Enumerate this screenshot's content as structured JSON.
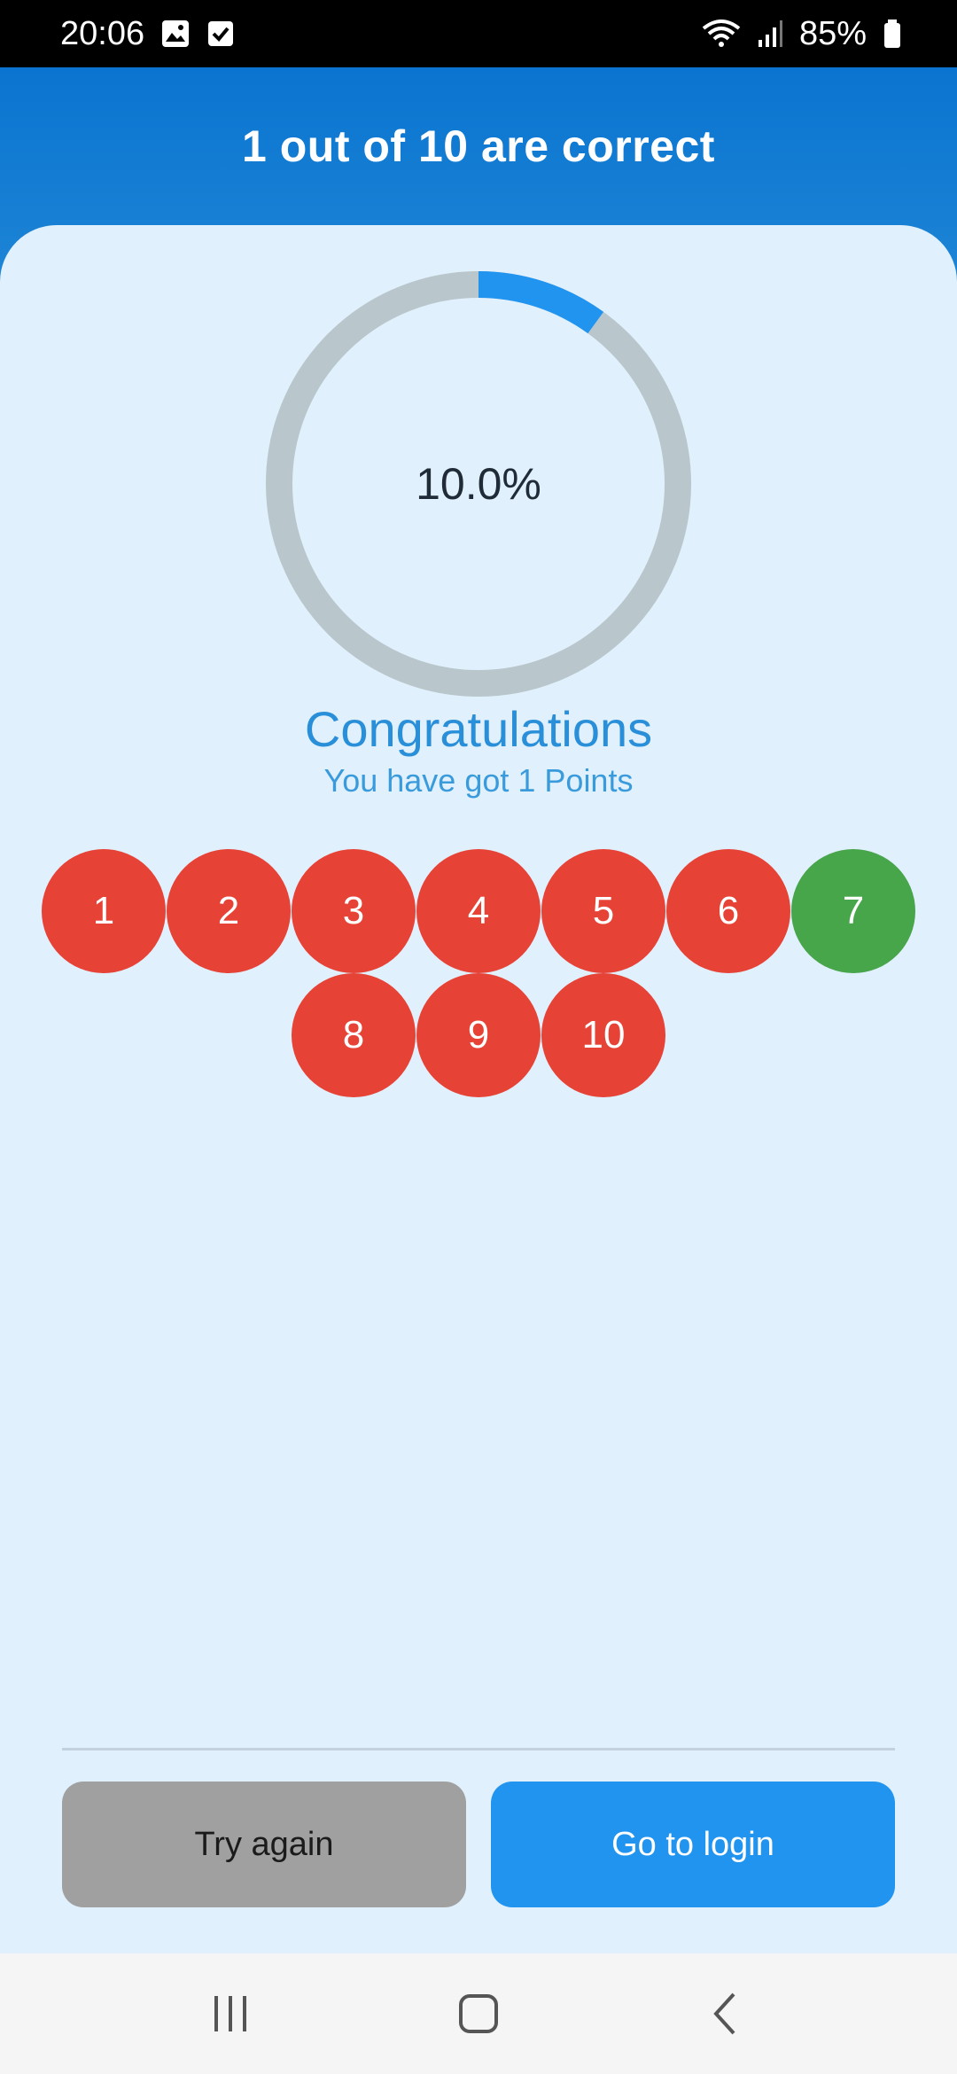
{
  "status_bar": {
    "time": "20:06",
    "battery": "85%"
  },
  "header": {
    "title": "1 out of 10 are correct"
  },
  "result": {
    "percent_text": "10.0%",
    "percent_value": 10.0,
    "congrats": "Congratulations",
    "points_text": "You have got 1 Points"
  },
  "answers": [
    {
      "label": "1",
      "status": "wrong"
    },
    {
      "label": "2",
      "status": "wrong"
    },
    {
      "label": "3",
      "status": "wrong"
    },
    {
      "label": "4",
      "status": "wrong"
    },
    {
      "label": "5",
      "status": "wrong"
    },
    {
      "label": "6",
      "status": "wrong"
    },
    {
      "label": "7",
      "status": "correct"
    },
    {
      "label": "8",
      "status": "wrong"
    },
    {
      "label": "9",
      "status": "wrong"
    },
    {
      "label": "10",
      "status": "wrong"
    }
  ],
  "buttons": {
    "try_again": "Try again",
    "go_to_login": "Go to login"
  },
  "colors": {
    "accent": "#2194f0",
    "correct": "#47a54a",
    "wrong": "#e64236",
    "ring_track": "#b9c7cc"
  }
}
